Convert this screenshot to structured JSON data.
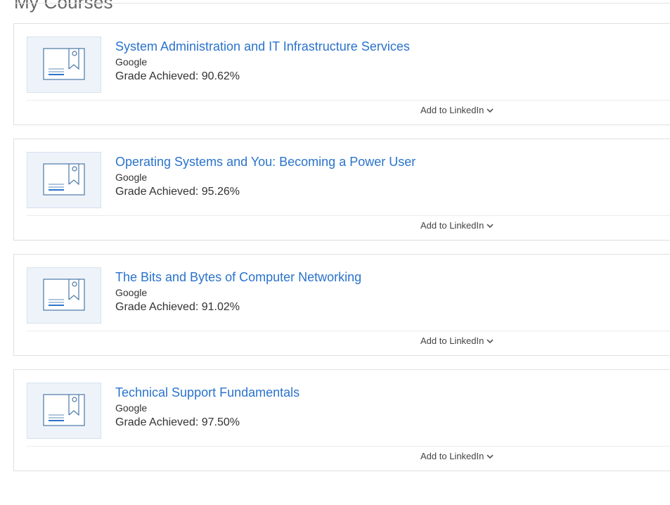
{
  "header": {
    "title": "My Courses"
  },
  "courses": [
    {
      "title": "System Administration and IT Infrastructure Services",
      "partner": "Google",
      "grade": "Grade Achieved: 90.62%",
      "action": "Add to LinkedIn"
    },
    {
      "title": "Operating Systems and You: Becoming a Power User",
      "partner": "Google",
      "grade": "Grade Achieved: 95.26%",
      "action": "Add to LinkedIn"
    },
    {
      "title": "The Bits and Bytes of Computer Networking",
      "partner": "Google",
      "grade": "Grade Achieved: 91.02%",
      "action": "Add to LinkedIn"
    },
    {
      "title": "Technical Support Fundamentals",
      "partner": "Google",
      "grade": "Grade Achieved: 97.50%",
      "action": "Add to LinkedIn"
    }
  ],
  "icons": {
    "thumbnail": "certificate-icon",
    "dropdown": "chevron-down-icon"
  },
  "colors": {
    "link": "#2a73cc",
    "thumb_bg": "#eef3fa"
  }
}
